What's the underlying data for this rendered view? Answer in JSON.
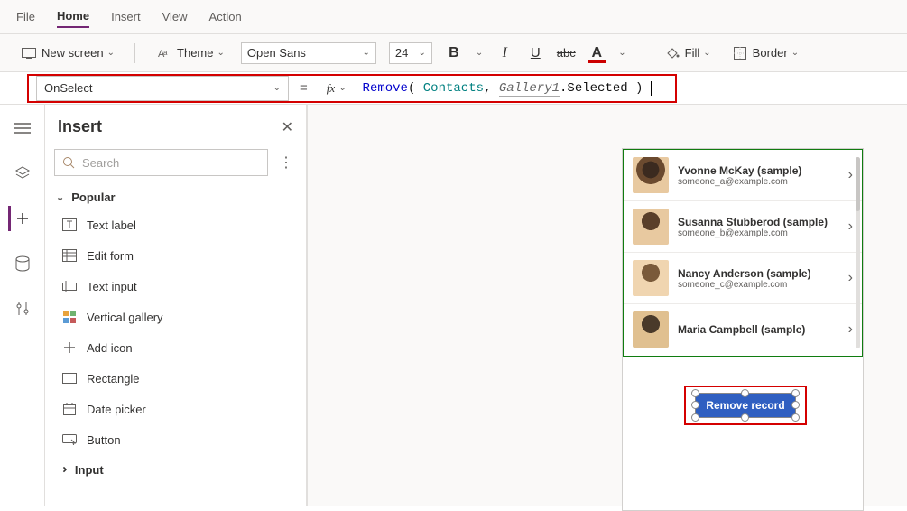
{
  "menu": {
    "file": "File",
    "home": "Home",
    "insert": "Insert",
    "view": "View",
    "action": "Action"
  },
  "toolbar": {
    "new_screen": "New screen",
    "theme": "Theme",
    "font_family": "Open Sans",
    "font_size": "24",
    "fill": "Fill",
    "border": "Border"
  },
  "formula": {
    "property": "OnSelect",
    "fn": "Remove",
    "arg1": "Contacts",
    "arg2a": "Gallery1",
    "arg2b": ".Selected"
  },
  "insert_panel": {
    "title": "Insert",
    "search_placeholder": "Search",
    "category": "Popular",
    "items": {
      "text_label": "Text label",
      "edit_form": "Edit form",
      "text_input": "Text input",
      "vertical_gallery": "Vertical gallery",
      "add_icon": "Add icon",
      "rectangle": "Rectangle",
      "date_picker": "Date picker",
      "button": "Button"
    },
    "sub_category": "Input"
  },
  "gallery": {
    "rows": [
      {
        "name": "Yvonne McKay (sample)",
        "email": "someone_a@example.com"
      },
      {
        "name": "Susanna Stubberod (sample)",
        "email": "someone_b@example.com"
      },
      {
        "name": "Nancy Anderson (sample)",
        "email": "someone_c@example.com"
      },
      {
        "name": "Maria Campbell (sample)",
        "email": ""
      }
    ]
  },
  "button": {
    "label": "Remove record"
  }
}
